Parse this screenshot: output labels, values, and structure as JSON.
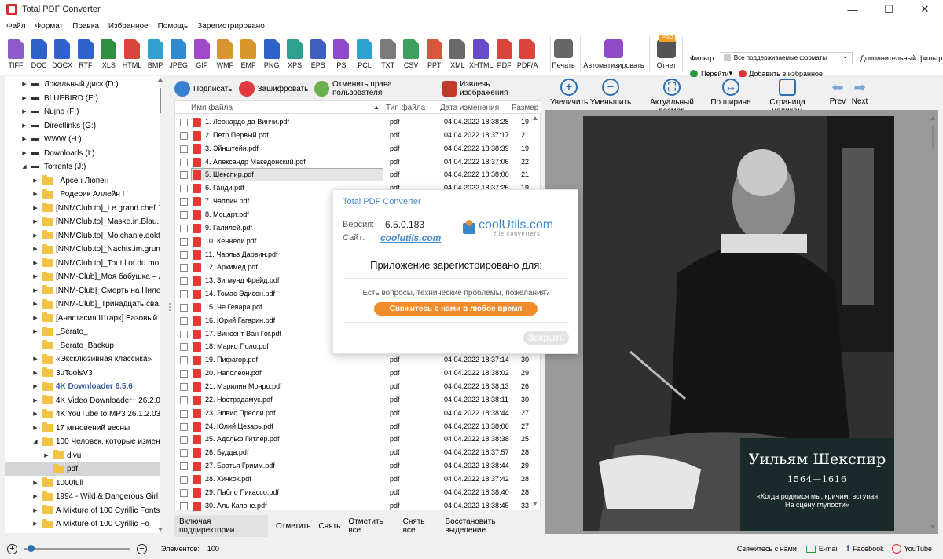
{
  "window": {
    "title": "Total PDF Converter",
    "min": "—",
    "max": "☐",
    "close": "✕"
  },
  "menu": [
    "Файл",
    "Формат",
    "Правка",
    "Избранное",
    "Помощь",
    "Зарегистрировано"
  ],
  "formats": [
    {
      "label": "TIFF",
      "color": "#8e5bc9"
    },
    {
      "label": "DOC",
      "color": "#2f62c9"
    },
    {
      "label": "DOCX",
      "color": "#2f62c9"
    },
    {
      "label": "RTF",
      "color": "#2f62c9"
    },
    {
      "label": "XLS",
      "color": "#2f8f3e"
    },
    {
      "label": "HTML",
      "color": "#d9453d"
    },
    {
      "label": "BMP",
      "color": "#2fa0d0"
    },
    {
      "label": "JPEG",
      "color": "#2f8ad0"
    },
    {
      "label": "GIF",
      "color": "#a04ac9"
    },
    {
      "label": "WMF",
      "color": "#d9962f"
    },
    {
      "label": "EMF",
      "color": "#d9962f"
    },
    {
      "label": "PNG",
      "color": "#2f62c9"
    },
    {
      "label": "XPS",
      "color": "#2fa08f"
    },
    {
      "label": "EPS",
      "color": "#3c5fc0"
    },
    {
      "label": "PS",
      "color": "#8e4ac9"
    },
    {
      "label": "PCL",
      "color": "#2fa0d0"
    },
    {
      "label": "TXT",
      "color": "#7a7a7a"
    },
    {
      "label": "CSV",
      "color": "#3f9f5f"
    },
    {
      "label": "PPT",
      "color": "#d9553d"
    },
    {
      "label": "XML",
      "color": "#6a6a6a"
    },
    {
      "label": "XHTML",
      "color": "#6a4ac9"
    },
    {
      "label": "PDF",
      "color": "#d9453d"
    },
    {
      "label": "PDF/A",
      "color": "#d9453d"
    }
  ],
  "toolbar": {
    "print": "Печать",
    "automate": "Автоматизировать",
    "report": "Отчет",
    "pro_badge": "PRO",
    "goto": "Перейти",
    "add_fav": "Добавить в избранное",
    "filter_label": "Фильтр:",
    "filter_value": "Все поддерживаемые форматы",
    "adv_filter": "Дополнительный фильтр"
  },
  "actions": {
    "sign": "Подписать",
    "encrypt": "Зашифровать",
    "revoke": "Отменить права пользователя",
    "extract": "Извлечь изображения"
  },
  "tree": [
    {
      "label": "Локальный диск (D:)",
      "type": "drive",
      "level": 0,
      "arrow": "▶"
    },
    {
      "label": "BLUEBIRD (E:)",
      "type": "drive",
      "level": 0,
      "arrow": "▶"
    },
    {
      "label": "Nujno (F:)",
      "type": "drive",
      "level": 0,
      "arrow": "▶"
    },
    {
      "label": "Directlinks (G:)",
      "type": "drive",
      "level": 0,
      "arrow": "▶"
    },
    {
      "label": "WWW (H:)",
      "type": "drive",
      "level": 0,
      "arrow": "▶"
    },
    {
      "label": "Downloads (I:)",
      "type": "drive",
      "level": 0,
      "arrow": "▶"
    },
    {
      "label": "Torrents (J:)",
      "type": "drive",
      "level": 0,
      "arrow": "◢"
    },
    {
      "label": "! Арсен Люпен !",
      "type": "folder",
      "level": 1,
      "arrow": "▶"
    },
    {
      "label": "! Родерик Аллейн !",
      "type": "folder",
      "level": 1,
      "arrow": "▶"
    },
    {
      "label": "[NNMClub.to]_Le.grand.chef.1",
      "type": "folder",
      "level": 1,
      "arrow": "▶"
    },
    {
      "label": "[NNMClub.to]_Maske.in.Blau.1",
      "type": "folder",
      "level": 1,
      "arrow": "▶"
    },
    {
      "label": "[NNMClub.to]_Molchanie.dokt",
      "type": "folder",
      "level": 1,
      "arrow": "▶"
    },
    {
      "label": "[NNMClub.to]_Nachts.im.grun",
      "type": "folder",
      "level": 1,
      "arrow": "▶"
    },
    {
      "label": "[NNMClub.to]_Tout.l.or.du.mo",
      "type": "folder",
      "level": 1,
      "arrow": "▶"
    },
    {
      "label": "[NNM-Club]_Моя бабушка – А",
      "type": "folder",
      "level": 1,
      "arrow": "▶"
    },
    {
      "label": "[NNM-Club]_Смерть на Ниле",
      "type": "folder",
      "level": 1,
      "arrow": "▶"
    },
    {
      "label": "[NNM-Club]_Тринадцать сва,",
      "type": "folder",
      "level": 1,
      "arrow": "▶"
    },
    {
      "label": "[Анастасия Штарк] Базовый",
      "type": "folder",
      "level": 1,
      "arrow": "▶"
    },
    {
      "label": "_Serato_",
      "type": "folder",
      "level": 1,
      "arrow": "▶"
    },
    {
      "label": "_Serato_Backup",
      "type": "folder",
      "level": 1,
      "arrow": ""
    },
    {
      "label": "«Эксклюзивная классика»",
      "type": "folder",
      "level": 1,
      "arrow": "▶"
    },
    {
      "label": "3uToolsV3",
      "type": "folder",
      "level": 1,
      "arrow": "▶"
    },
    {
      "label": "4K Downloader 6.5.6",
      "type": "folder",
      "level": 1,
      "arrow": "▶",
      "blue": true
    },
    {
      "label": "4K Video Downloader+ 26.2.0",
      "type": "folder",
      "level": 1,
      "arrow": "▶"
    },
    {
      "label": "4K YouTube to MP3 26.1.2.03",
      "type": "folder",
      "level": 1,
      "arrow": "▶"
    },
    {
      "label": "17 мгновений весны",
      "type": "folder",
      "level": 1,
      "arrow": "▶"
    },
    {
      "label": "100 Человек, которые измен",
      "type": "folder",
      "level": 1,
      "arrow": "◢"
    },
    {
      "label": "djvu",
      "type": "folder",
      "level": 2,
      "arrow": "▶"
    },
    {
      "label": "pdf",
      "type": "folder",
      "level": 2,
      "arrow": "",
      "selected": true
    },
    {
      "label": "1000full",
      "type": "folder",
      "level": 1,
      "arrow": "▶"
    },
    {
      "label": "1994 - Wild & Dangerous Girl",
      "type": "folder",
      "level": 1,
      "arrow": "▶"
    },
    {
      "label": "A Mixture of 100 Cyrillic Fonts",
      "type": "folder",
      "level": 1,
      "arrow": "▶"
    },
    {
      "label": "A Mixture of 100 Cyrillic Fo",
      "type": "folder",
      "level": 1,
      "arrow": "▶"
    }
  ],
  "columns": {
    "name": "Имя файла",
    "type": "Тип файла",
    "date": "Дата изменения",
    "size": "Размер"
  },
  "files": [
    {
      "name": "1. Леонардо да Винчи.pdf",
      "type": "pdf",
      "date": "04.04.2022 18:38:28",
      "size": "19"
    },
    {
      "name": "2. Петр Первый.pdf",
      "type": "pdf",
      "date": "04.04.2022 18:37:17",
      "size": "21"
    },
    {
      "name": "3. Эйнштейн.pdf",
      "type": "pdf",
      "date": "04.04.2022 18:38:39",
      "size": "19"
    },
    {
      "name": "4. Александр Македонский.pdf",
      "type": "pdf",
      "date": "04.04.2022 18:37:06",
      "size": "22"
    },
    {
      "name": "5. Шекспир.pdf",
      "type": "pdf",
      "date": "04.04.2022 18:38:00",
      "size": "21",
      "selected": true
    },
    {
      "name": "6. Ганди.pdf",
      "type": "pdf",
      "date": "04.04.2022 18:37:25",
      "size": "19"
    },
    {
      "name": "7. Чаплин.pdf",
      "type": "pdf",
      "date": "",
      "size": ""
    },
    {
      "name": "8. Моцарт.pdf",
      "type": "",
      "date": "",
      "size": ""
    },
    {
      "name": "9. Галилей.pdf",
      "type": "",
      "date": "",
      "size": ""
    },
    {
      "name": "10. Кеннеди.pdf",
      "type": "",
      "date": "",
      "size": ""
    },
    {
      "name": "11. Чарльз Дарвин.pdf",
      "type": "",
      "date": "",
      "size": ""
    },
    {
      "name": "12. Архимед.pdf",
      "type": "",
      "date": "",
      "size": ""
    },
    {
      "name": "13. Зигмунд Фрейд.pdf",
      "type": "",
      "date": "",
      "size": ""
    },
    {
      "name": "14. Томас Эдисон.pdf",
      "type": "",
      "date": "",
      "size": ""
    },
    {
      "name": "15. Че Гевара.pdf",
      "type": "",
      "date": "",
      "size": ""
    },
    {
      "name": "16. Юрий Гагарин.pdf",
      "type": "",
      "date": "",
      "size": ""
    },
    {
      "name": "17. Винсент Ван Гог.pdf",
      "type": "",
      "date": "",
      "size": ""
    },
    {
      "name": "18. Марко Поло.pdf",
      "type": "",
      "date": "",
      "size": ""
    },
    {
      "name": "19. Пифагор.pdf",
      "type": "pdf",
      "date": "04.04.2022 18:37:14",
      "size": "30"
    },
    {
      "name": "20. Наполеон.pdf",
      "type": "pdf",
      "date": "04.04.2022 18:38:02",
      "size": "29"
    },
    {
      "name": "21. Мэрилин Монро.pdf",
      "type": "pdf",
      "date": "04.04.2022 18:38:13",
      "size": "26"
    },
    {
      "name": "22. Нострадамус.pdf",
      "type": "pdf",
      "date": "04.04.2022 18:38:11",
      "size": "30"
    },
    {
      "name": "23. Элвис Пресли.pdf",
      "type": "pdf",
      "date": "04.04.2022 18:38:44",
      "size": "27"
    },
    {
      "name": "24. Юлий Цезарь.pdf",
      "type": "pdf",
      "date": "04.04.2022 18:38:06",
      "size": "27"
    },
    {
      "name": "25. Адольф Гитлер.pdf",
      "type": "pdf",
      "date": "04.04.2022 18:38:38",
      "size": "25"
    },
    {
      "name": "26. Будда.pdf",
      "type": "pdf",
      "date": "04.04.2022 18:37:57",
      "size": "28"
    },
    {
      "name": "27. Братья Гримм.pdf",
      "type": "pdf",
      "date": "04.04.2022 18:38:44",
      "size": "29"
    },
    {
      "name": "28. Хичкок.pdf",
      "type": "pdf",
      "date": "04.04.2022 18:37:42",
      "size": "28"
    },
    {
      "name": "29. Пабло Пикассо.pdf",
      "type": "pdf",
      "date": "04.04.2022 18:38:40",
      "size": "28"
    },
    {
      "name": "30. Аль Капоне.pdf",
      "type": "pdf",
      "date": "04.04.2022 18:38:45",
      "size": "33"
    }
  ],
  "bottom": {
    "include_sub": "Включая поддиректории",
    "check": "Отметить",
    "uncheck": "Снять",
    "check_all": "Отметить все",
    "uncheck_all": "Снять все",
    "restore": "Восстановить выделение"
  },
  "viewer_tools": {
    "zoom_in": "Увеличить",
    "zoom_out": "Уменьшить",
    "actual": "Актуальный размер",
    "fit_width": "По ширине",
    "fit_page": "Страница целиком",
    "prev": "Prev",
    "next": "Next"
  },
  "preview": {
    "name": "Уильям Шекспир",
    "years": "1564—1616",
    "quote": "«Когда родимся мы, кричим, вступая\nНа сцену глупости»"
  },
  "dialog": {
    "title": "Total PDF Converter",
    "version_label": "Версия:",
    "version": "6.5.0.183",
    "site_label": "Сайт:",
    "site": "coolutils.com",
    "logo_name": "coolUtils.com",
    "logo_sub": "file converters",
    "registered": "Приложение зарегистрировано для:",
    "question": "Есть вопросы, технические проблемы, пожелания?",
    "contact": "Свяжитесь с нами в любое время",
    "close": "Закрыть"
  },
  "status": {
    "zoom_level": 0.05,
    "elements_label": "Элементов:",
    "elements": "100",
    "contact": "Свяжитесь с нами",
    "email": "E-mail",
    "facebook": "Facebook",
    "youtube": "YouTube"
  }
}
